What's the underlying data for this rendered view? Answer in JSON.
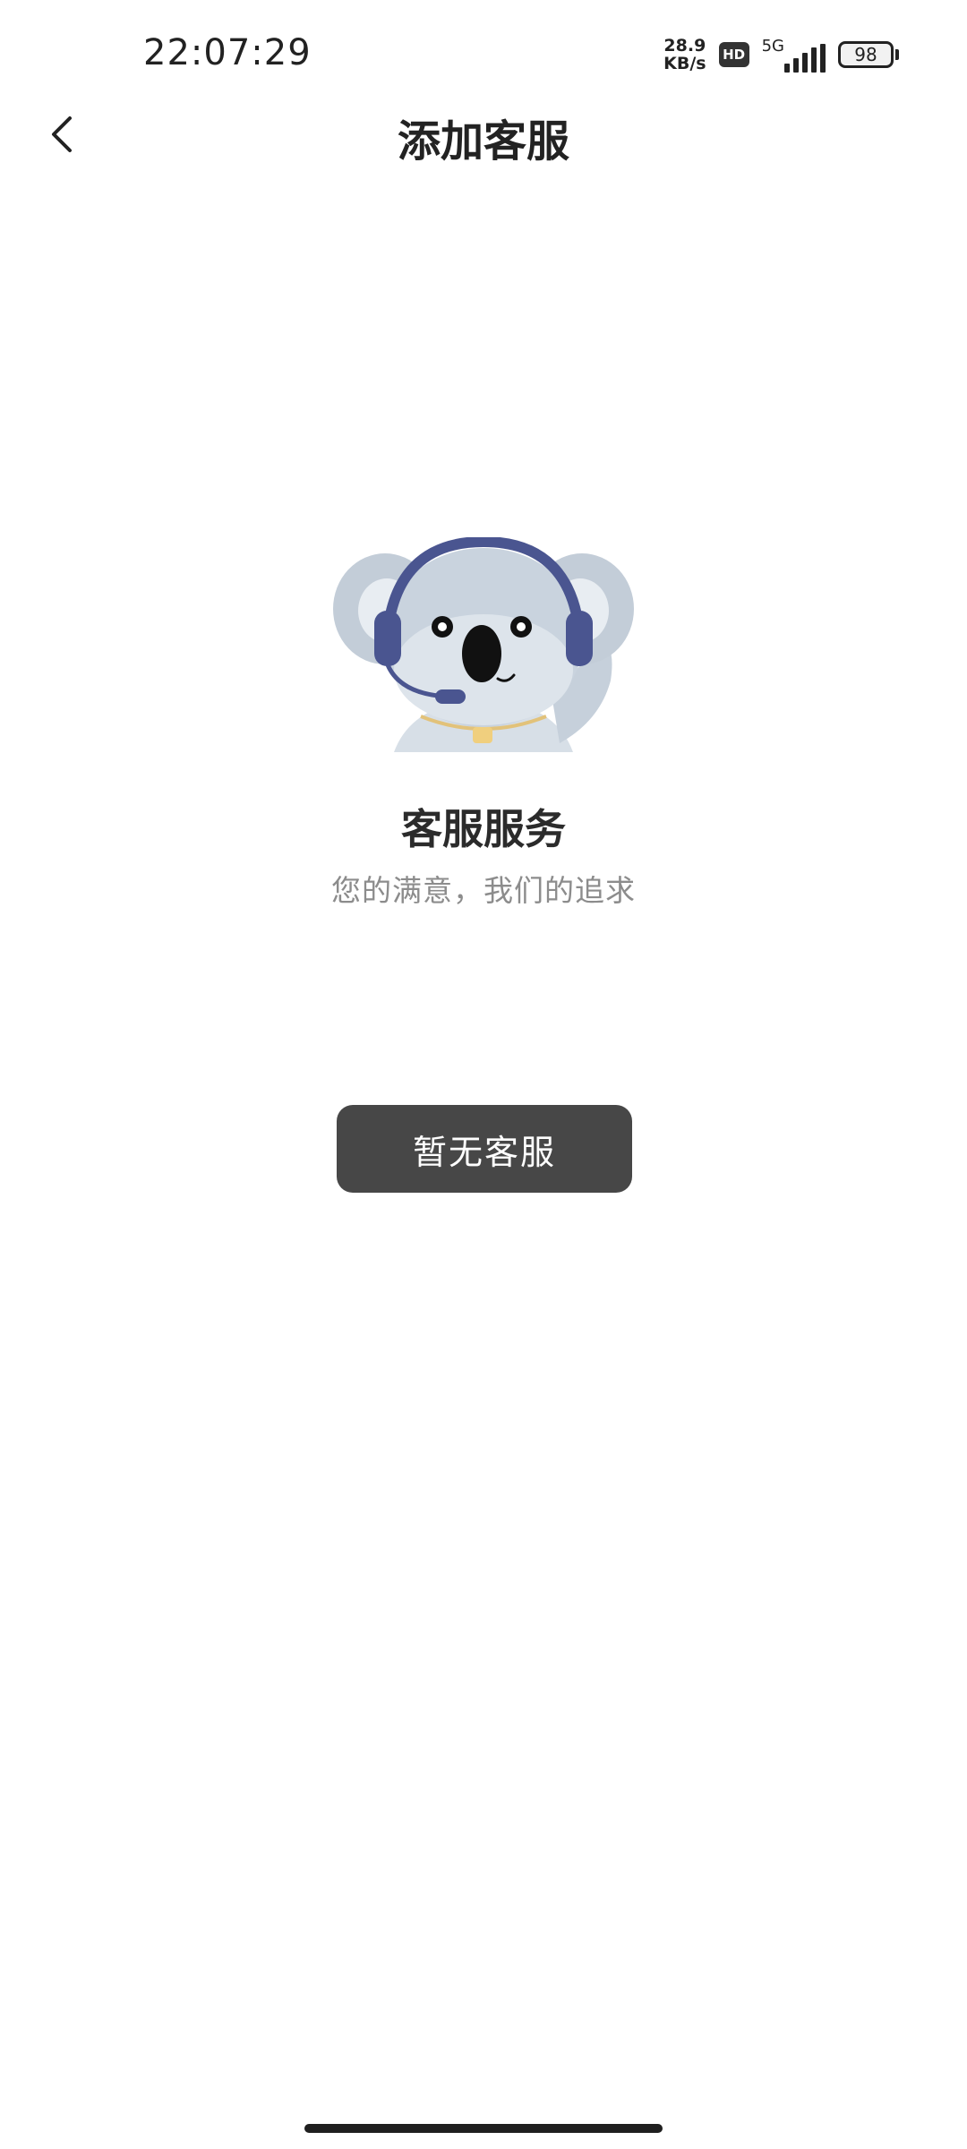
{
  "status_bar": {
    "time": "22:07:29",
    "net_speed_value": "28.9",
    "net_speed_unit": "KB/s",
    "hd_label": "HD",
    "signal_type": "5G",
    "battery_level": "98"
  },
  "header": {
    "back_icon": "chevron-left-icon",
    "title": "添加客服"
  },
  "main": {
    "illustration": "koala-headset-mascot",
    "service_title": "客服服务",
    "service_subtitle": "您的满意，我们的追求",
    "button_label": "暂无客服"
  },
  "colors": {
    "button_bg": "#474747",
    "subtitle": "#8c8c8c",
    "headset": "#4a5590",
    "koala": "#c9d3de"
  }
}
